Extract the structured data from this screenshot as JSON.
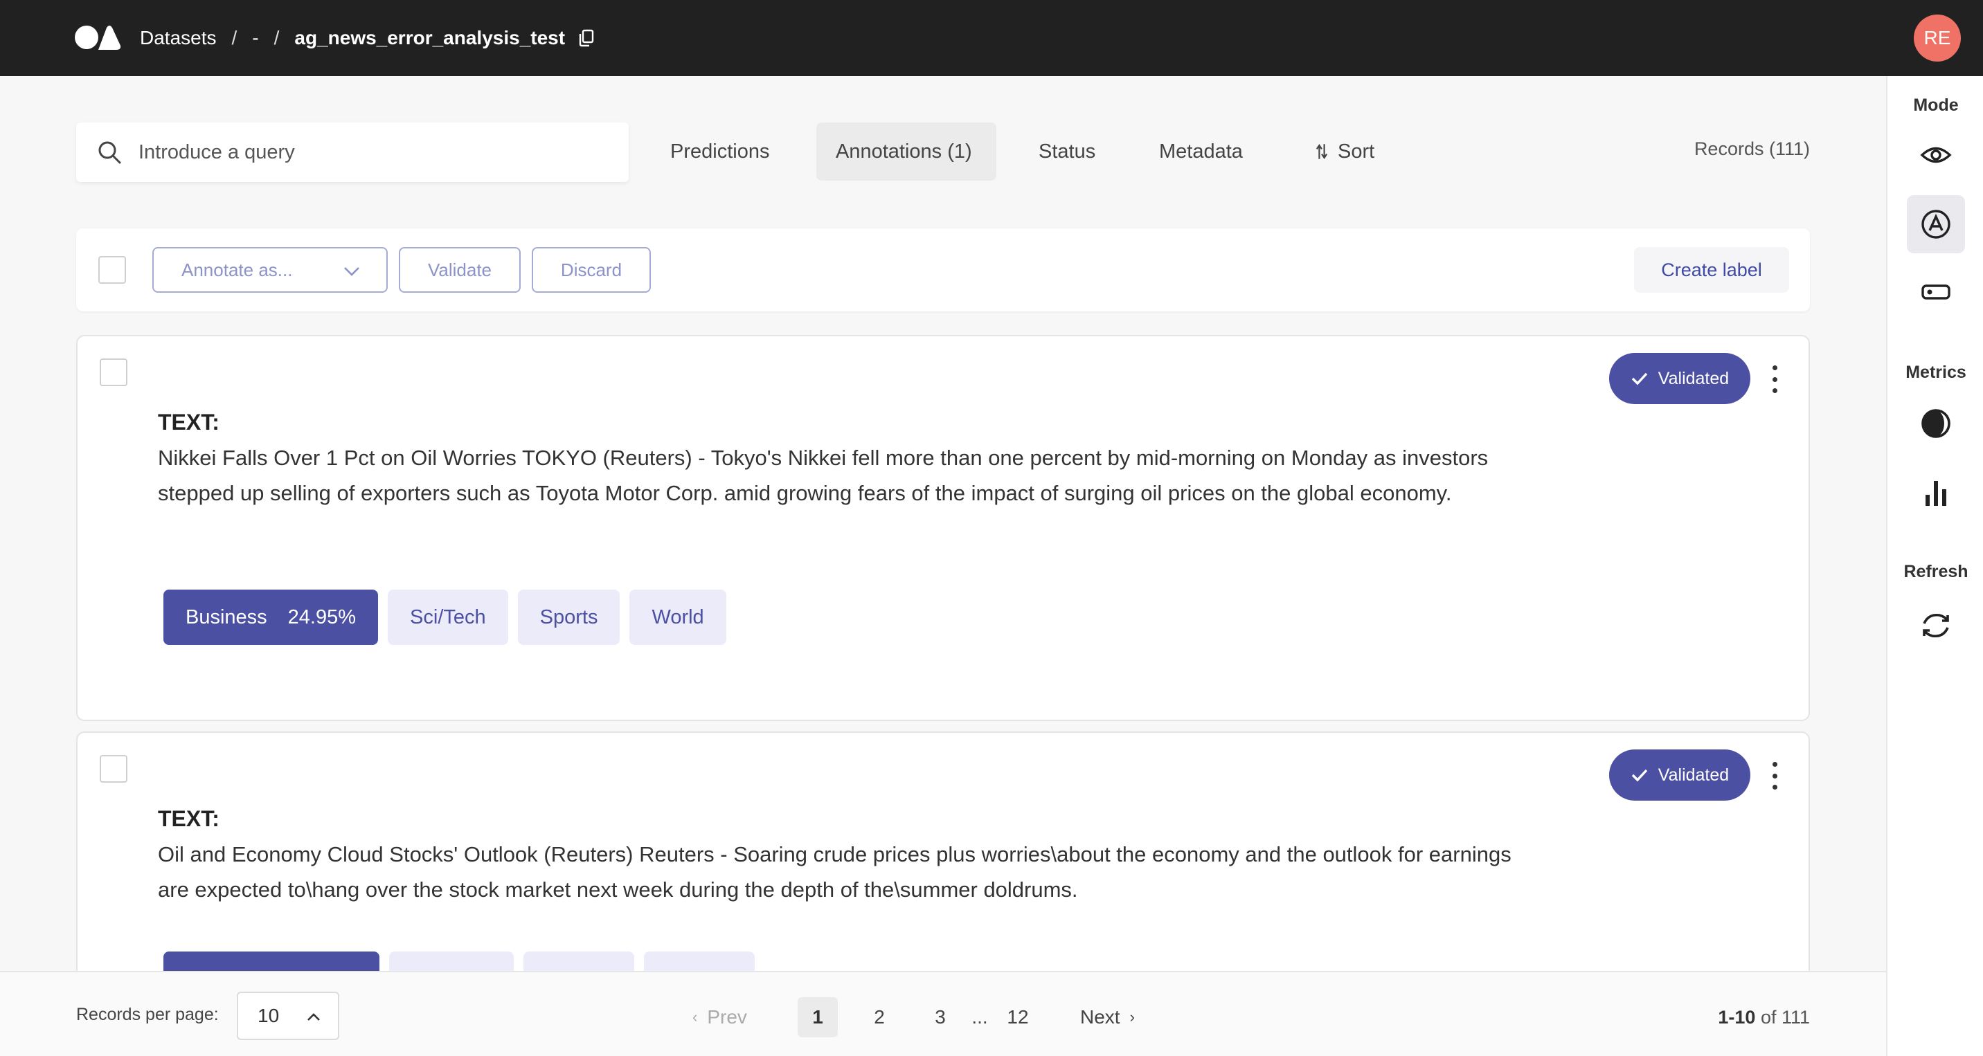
{
  "header": {
    "breadcrumbs": [
      "Datasets",
      "-",
      "ag_news_error_analysis_test"
    ],
    "separator": "/",
    "avatar_initials": "RE"
  },
  "search": {
    "placeholder": "Introduce a query",
    "value": ""
  },
  "filters": {
    "predictions": "Predictions",
    "annotations": "Annotations (1)",
    "status": "Status",
    "metadata": "Metadata",
    "sort": "Sort"
  },
  "records_count": "Records (111)",
  "bulk": {
    "annotate_as": "Annotate as...",
    "validate": "Validate",
    "discard": "Discard",
    "create_label": "Create label"
  },
  "sidebar": {
    "mode_title": "Mode",
    "metrics_title": "Metrics",
    "refresh_title": "Refresh"
  },
  "records": [
    {
      "status": "Validated",
      "text_label": "TEXT:",
      "text": "Nikkei Falls Over 1 Pct on Oil Worries TOKYO (Reuters) - Tokyo's Nikkei fell more than one percent by mid-morning on Monday as investors stepped up selling of exporters such as Toyota Motor Corp. amid growing fears of the impact of surging oil prices on the global economy.",
      "labels": [
        {
          "name": "Business",
          "score": "24.95%",
          "selected": true
        },
        {
          "name": "Sci/Tech",
          "selected": false
        },
        {
          "name": "Sports",
          "selected": false
        },
        {
          "name": "World",
          "selected": false
        }
      ]
    },
    {
      "status": "Validated",
      "text_label": "TEXT:",
      "text": "Oil and Economy Cloud Stocks' Outlook (Reuters) Reuters - Soaring crude prices plus worries\\about the economy and the outlook for earnings are expected to\\hang over the stock market next week during the depth of the\\summer doldrums."
    }
  ],
  "pagination": {
    "records_per_page_label": "Records per page:",
    "records_per_page": "10",
    "prev": "Prev",
    "pages": [
      "1",
      "2",
      "3",
      "12"
    ],
    "ellipsis": "...",
    "next": "Next",
    "range_bold": "1-10",
    "range_rest": " of 111"
  },
  "colors": {
    "topbar": "#212121",
    "accent": "#4c50a3",
    "chip_bg": "#ebebf9",
    "avatar": "#f07266"
  }
}
